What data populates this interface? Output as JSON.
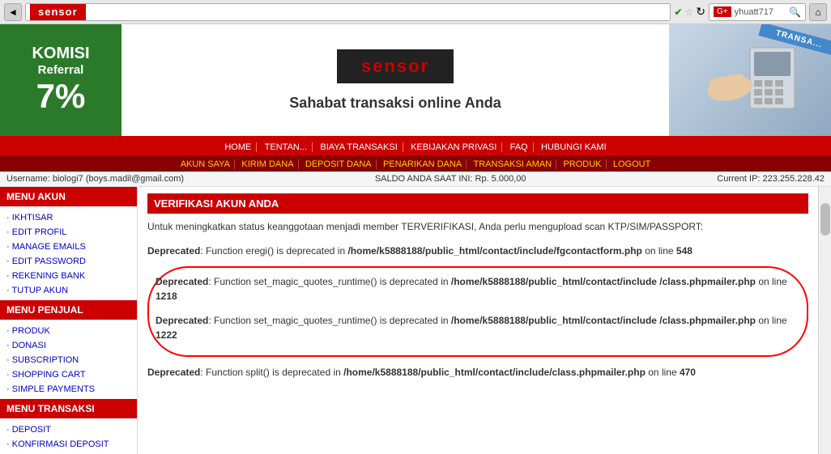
{
  "browser": {
    "back_label": "◄",
    "page_title": "sensor",
    "address_url": "sensor",
    "status_check": "✔",
    "star_icon": "☆",
    "reload_icon": "↻",
    "search_engine": "yhuatt717",
    "search_placeholder": "",
    "home_icon": "⌂"
  },
  "header": {
    "komisi_label": "KOMISI",
    "referral_label": "Referral",
    "percent_label": "7%",
    "sensor_label": "sensor",
    "tagline": "Sahabat transaksi online Anda",
    "transaksi_ribbon": "TRANSA..."
  },
  "nav_top": {
    "items": [
      {
        "label": "HOME"
      },
      {
        "label": "TENTAN..."
      },
      {
        "label": "BIAYA TRANSAKSI"
      },
      {
        "label": "KEBIJAKAN PRIVASI"
      },
      {
        "label": "FAQ"
      },
      {
        "label": "HUBUNGI KAMI"
      }
    ]
  },
  "nav_bottom": {
    "items": [
      {
        "label": "AKUN SAYA"
      },
      {
        "label": "KIRIM DANA"
      },
      {
        "label": "DEPOSIT DANA"
      },
      {
        "label": "PENARIKAN DANA"
      },
      {
        "label": "TRANSAKSI AMAN"
      },
      {
        "label": "PRODUK"
      },
      {
        "label": "LOGOUT"
      }
    ]
  },
  "user_info": {
    "username_label": "Username: biologi7 (boys.madil@gmail.com)",
    "saldo_label": "SALDO ANDA SAAT INI: Rp. 5.000,00",
    "ip_label": "Current IP: 223.255.228.42"
  },
  "sidebar": {
    "menu_akun": {
      "title": "MENU AKUN",
      "items": [
        {
          "label": "IKHTISAR"
        },
        {
          "label": "EDIT PROFIL"
        },
        {
          "label": "MANAGE EMAILS"
        },
        {
          "label": "EDIT PASSWORD"
        },
        {
          "label": "REKENING BANK"
        },
        {
          "label": "TUTUP AKUN"
        }
      ]
    },
    "menu_penjual": {
      "title": "MENU PENJUAL",
      "items": [
        {
          "label": "PRODUK"
        },
        {
          "label": "DONASI"
        },
        {
          "label": "SUBSCRIPTION"
        },
        {
          "label": "SHOPPING CART"
        },
        {
          "label": "SIMPLE PAYMENTS"
        }
      ]
    },
    "menu_transaksi": {
      "title": "MENU TRANSAKSI",
      "items": [
        {
          "label": "DEPOSIT"
        },
        {
          "label": "KONFIRMASI DEPOSIT"
        }
      ]
    }
  },
  "content": {
    "page_title": "VERIFIKASI AKUN ANDA",
    "intro": "Untuk meningkatkan status keanggotaan menjadi member TERVERIFIKASI, Anda perlu mengupload scan KTP/SIM/PASSPORT:",
    "deprecation_1": {
      "bold": "Deprecated",
      "text": ": Function eregi() is deprecated in ",
      "path": "/home/k5888188/public_html/contact/include/fgcontactform.php",
      "line_label": " on line ",
      "line": "548"
    },
    "deprecation_2": {
      "bold": "Deprecated",
      "text": ": Function set_magic_quotes_runtime() is deprecated in ",
      "path": "/home/k5888188/public_html/contact/include /class.phpmailer.php",
      "line_label": " on line ",
      "line": "1218"
    },
    "deprecation_3": {
      "bold": "Deprecated",
      "text": ": Function set_magic_quotes_runtime() is deprecated in ",
      "path": "/home/k5888188/public_html/contact/include /class.phpmailer.php",
      "line_label": " on line ",
      "line": "1222"
    },
    "deprecation_4": {
      "bold": "Deprecated",
      "text": ": Function split() is deprecated in ",
      "path": "/home/k5888188/public_html/contact/include/class.phpmailer.php",
      "line_label": " on line ",
      "line": "470"
    }
  }
}
